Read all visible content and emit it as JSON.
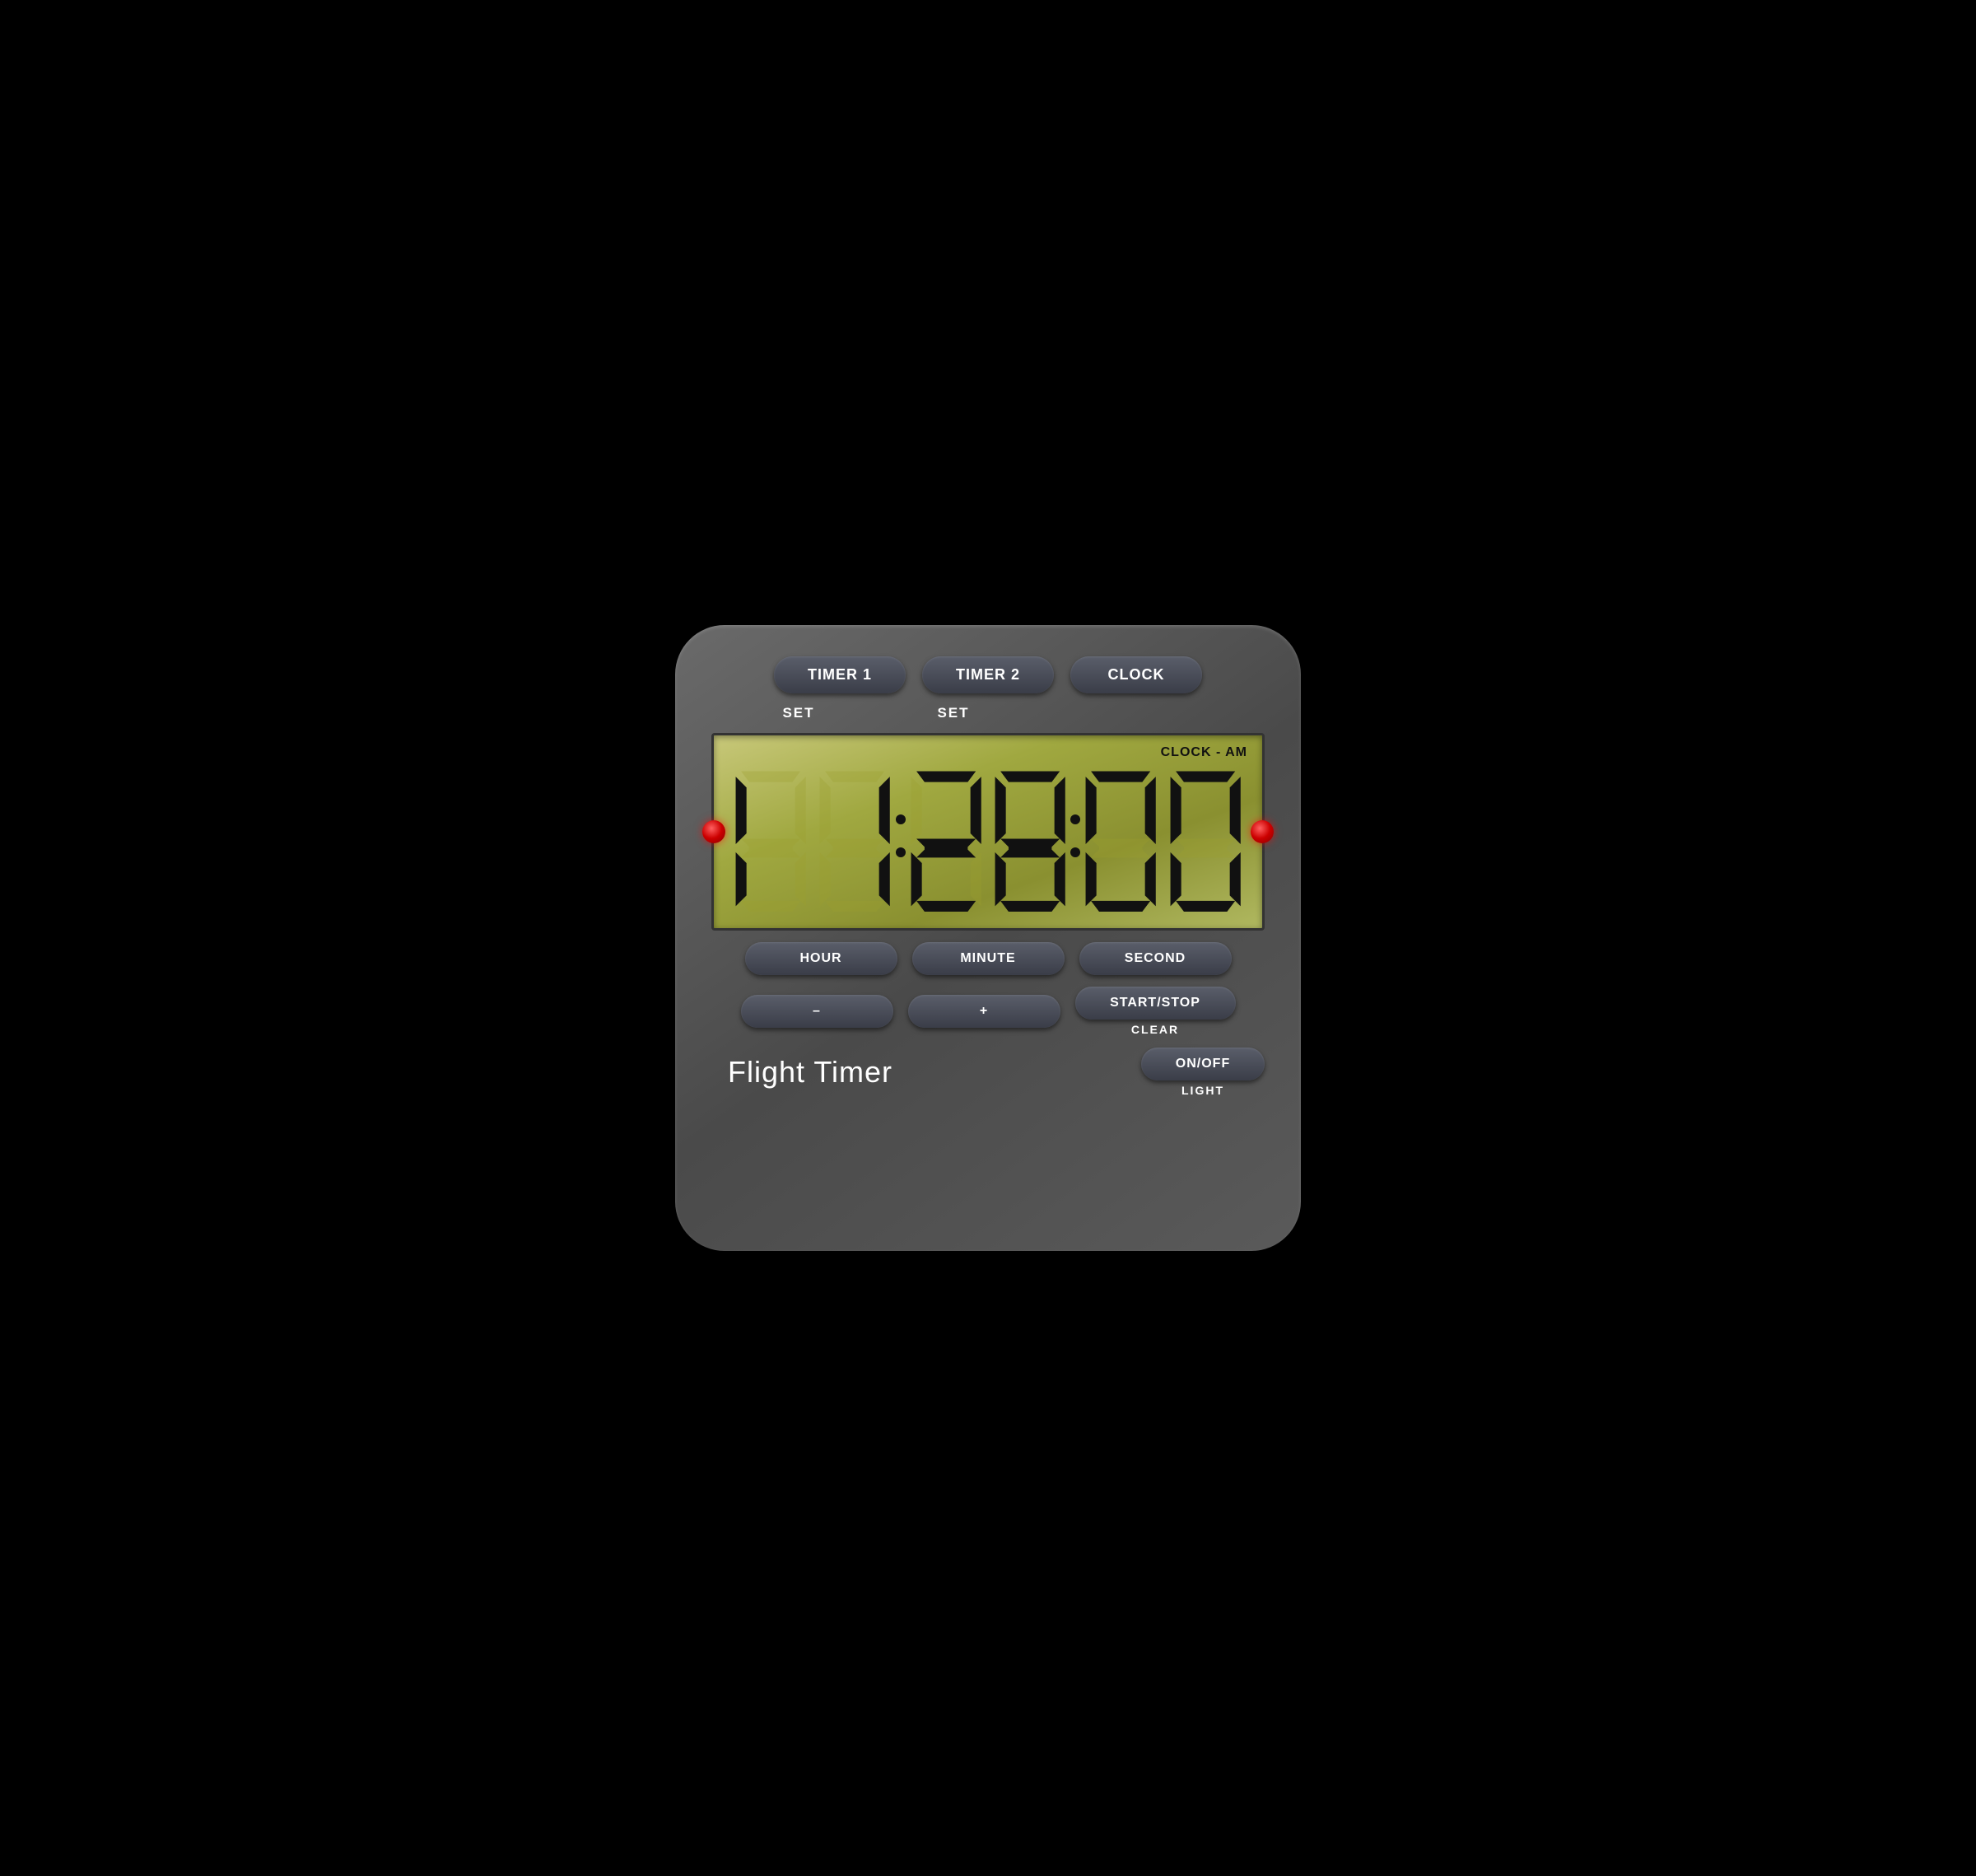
{
  "device": {
    "title": "Flight Timer"
  },
  "top_buttons": [
    {
      "id": "timer1",
      "label": "TIMER 1"
    },
    {
      "id": "timer2",
      "label": "TIMER 2"
    },
    {
      "id": "clock",
      "label": "CLOCK"
    }
  ],
  "set_labels": [
    "SET",
    "SET"
  ],
  "display": {
    "mode_label": "CLOCK - AM",
    "time_value": "01:28:00"
  },
  "bottom_buttons_row1": [
    {
      "id": "hour",
      "label": "HOUR"
    },
    {
      "id": "minute",
      "label": "MINUTE"
    },
    {
      "id": "second",
      "label": "SECOND"
    }
  ],
  "bottom_buttons_row2_left": [
    {
      "id": "minus",
      "label": "–"
    },
    {
      "id": "plus",
      "label": "+"
    }
  ],
  "start_stop": {
    "button_label": "START/STOP",
    "sub_label": "CLEAR"
  },
  "on_off": {
    "button_label": "ON/OFF",
    "sub_label": "LIGHT"
  }
}
